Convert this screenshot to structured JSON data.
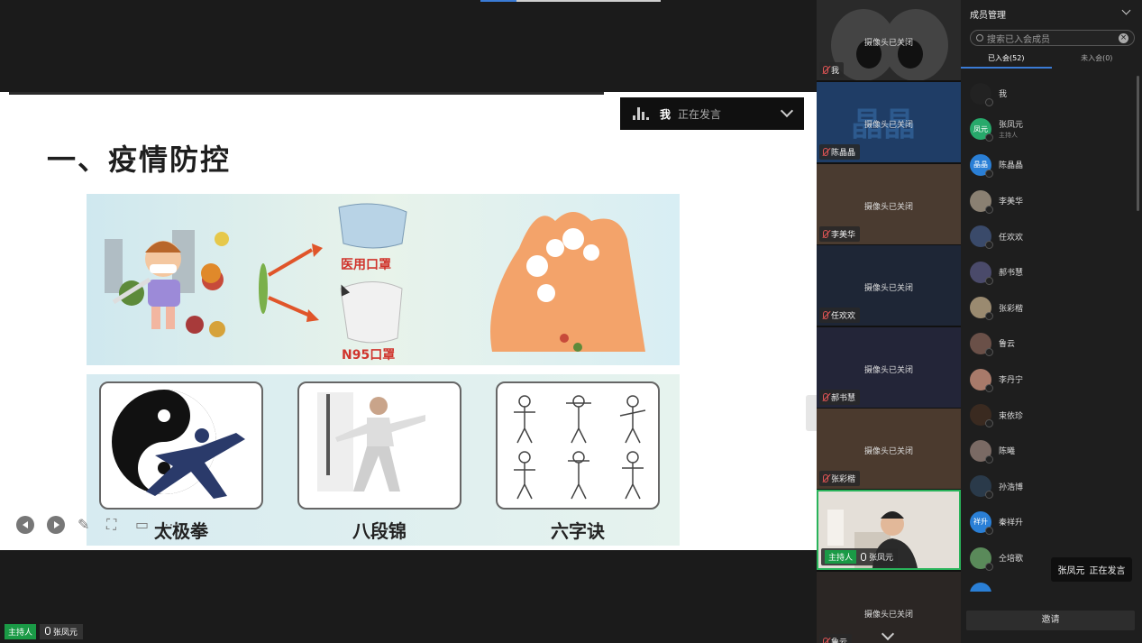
{
  "speaking_indicator": {
    "who": "我",
    "state": "正在发言"
  },
  "slide": {
    "title": "一、疫情防控",
    "top_image": {
      "mask1_label": "医用口罩",
      "mask2_label": "N95口罩"
    },
    "bottom_image": {
      "labels": [
        "太极拳",
        "八段锦",
        "六字诀"
      ]
    }
  },
  "host_tag": {
    "role": "主持人",
    "name": "张凤元"
  },
  "video_tiles": [
    {
      "name": "我",
      "status": "摄像头已关闭",
      "bg": "#2a2a2a"
    },
    {
      "name": "陈晶晶",
      "status": "摄像头已关闭",
      "bg": "#1f3d66",
      "overlay": "晶晶"
    },
    {
      "name": "李美华",
      "status": "摄像头已关闭",
      "bg": "#4a3b30"
    },
    {
      "name": "任欢欢",
      "status": "摄像头已关闭",
      "bg": "#1e2636"
    },
    {
      "name": "郝书慧",
      "status": "摄像头已关闭",
      "bg": "#232538"
    },
    {
      "name": "张彩楷",
      "status": "摄像头已关闭",
      "bg": "#4b3a2e"
    },
    {
      "name": "张凤元",
      "role": "主持人",
      "status": "",
      "bg": "#d9d4cc"
    },
    {
      "name": "鲁云",
      "status": "摄像头已关闭",
      "bg": "#2b2624"
    }
  ],
  "members": {
    "title": "成员管理",
    "search_placeholder": "搜索已入会成员",
    "tab_joined": "已入会(52)",
    "tab_not_joined": "未入会(0)",
    "list": [
      {
        "name": "我",
        "avatar_color": "#222",
        "avatar_text": ""
      },
      {
        "name": "张凤元",
        "sub": "主持人",
        "avatar_color": "#27a96b",
        "avatar_text": "凤元"
      },
      {
        "name": "陈晶晶",
        "avatar_color": "#2a7fd6",
        "avatar_text": "晶晶"
      },
      {
        "name": "李美华",
        "avatar_color": "#8a8072",
        "avatar_text": ""
      },
      {
        "name": "任欢欢",
        "avatar_color": "#3a4a6a",
        "avatar_text": ""
      },
      {
        "name": "郝书慧",
        "avatar_color": "#4a4a6a",
        "avatar_text": ""
      },
      {
        "name": "张彩楷",
        "avatar_color": "#9a8a70",
        "avatar_text": ""
      },
      {
        "name": "鲁云",
        "avatar_color": "#6a5048",
        "avatar_text": ""
      },
      {
        "name": "李丹宁",
        "avatar_color": "#a87a6a",
        "avatar_text": ""
      },
      {
        "name": "束依珍",
        "avatar_color": "#3a2a20",
        "avatar_text": ""
      },
      {
        "name": "陈曦",
        "avatar_color": "#7a6a64",
        "avatar_text": ""
      },
      {
        "name": "孙浩博",
        "avatar_color": "#2a3a4a",
        "avatar_text": ""
      },
      {
        "name": "秦祥升",
        "avatar_color": "#2a7fd6",
        "avatar_text": "祥升"
      },
      {
        "name": "仝培歌",
        "avatar_color": "#5a8a5a",
        "avatar_text": ""
      },
      {
        "name": "",
        "avatar_color": "#2a7fd6",
        "avatar_text": ""
      }
    ],
    "invite_label": "邀请"
  },
  "toast": {
    "name": "张凤元",
    "state": "正在发言"
  }
}
